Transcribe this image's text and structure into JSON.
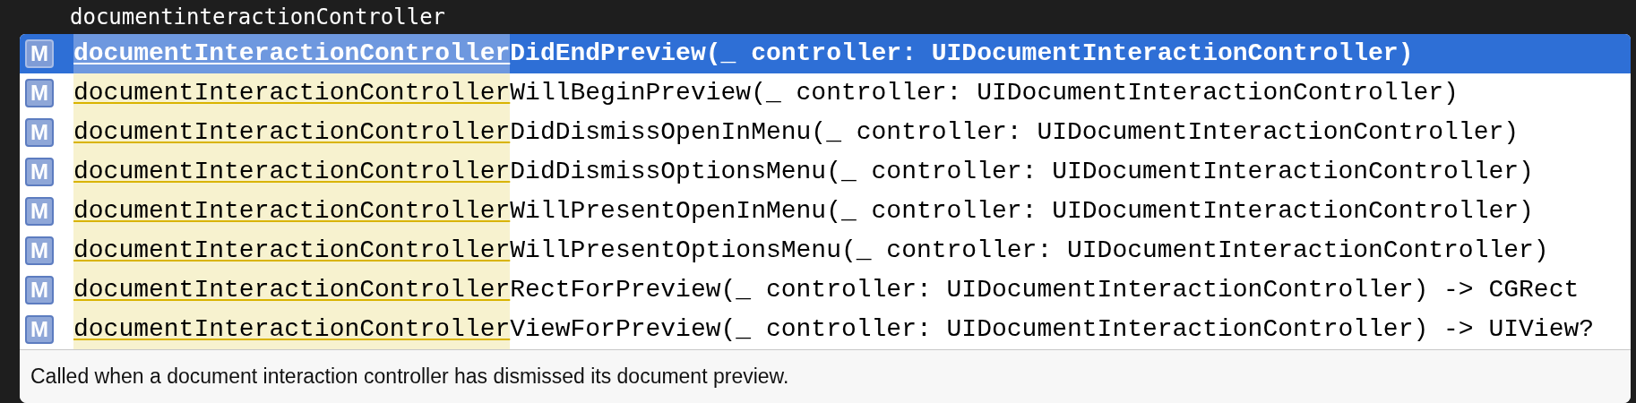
{
  "editor_line": "documentinteractionController",
  "completions": [
    {
      "icon": "M",
      "match": "documentInteractionController",
      "rest": "DidEndPreview(_ controller: UIDocumentInteractionController)",
      "selected": true
    },
    {
      "icon": "M",
      "match": "documentInteractionController",
      "rest": "WillBeginPreview(_ controller: UIDocumentInteractionController)",
      "selected": false
    },
    {
      "icon": "M",
      "match": "documentInteractionController",
      "rest": "DidDismissOpenInMenu(_ controller: UIDocumentInteractionController)",
      "selected": false
    },
    {
      "icon": "M",
      "match": "documentInteractionController",
      "rest": "DidDismissOptionsMenu(_ controller: UIDocumentInteractionController)",
      "selected": false
    },
    {
      "icon": "M",
      "match": "documentInteractionController",
      "rest": "WillPresentOpenInMenu(_ controller: UIDocumentInteractionController)",
      "selected": false
    },
    {
      "icon": "M",
      "match": "documentInteractionController",
      "rest": "WillPresentOptionsMenu(_ controller: UIDocumentInteractionController)",
      "selected": false
    },
    {
      "icon": "M",
      "match": "documentInteractionController",
      "rest": "RectForPreview(_ controller: UIDocumentInteractionController) -> CGRect",
      "selected": false
    },
    {
      "icon": "M",
      "match": "documentInteractionController",
      "rest": "ViewForPreview(_ controller: UIDocumentInteractionController) -> UIView?",
      "selected": false
    }
  ],
  "description": "Called when a document interaction controller has dismissed its document preview."
}
